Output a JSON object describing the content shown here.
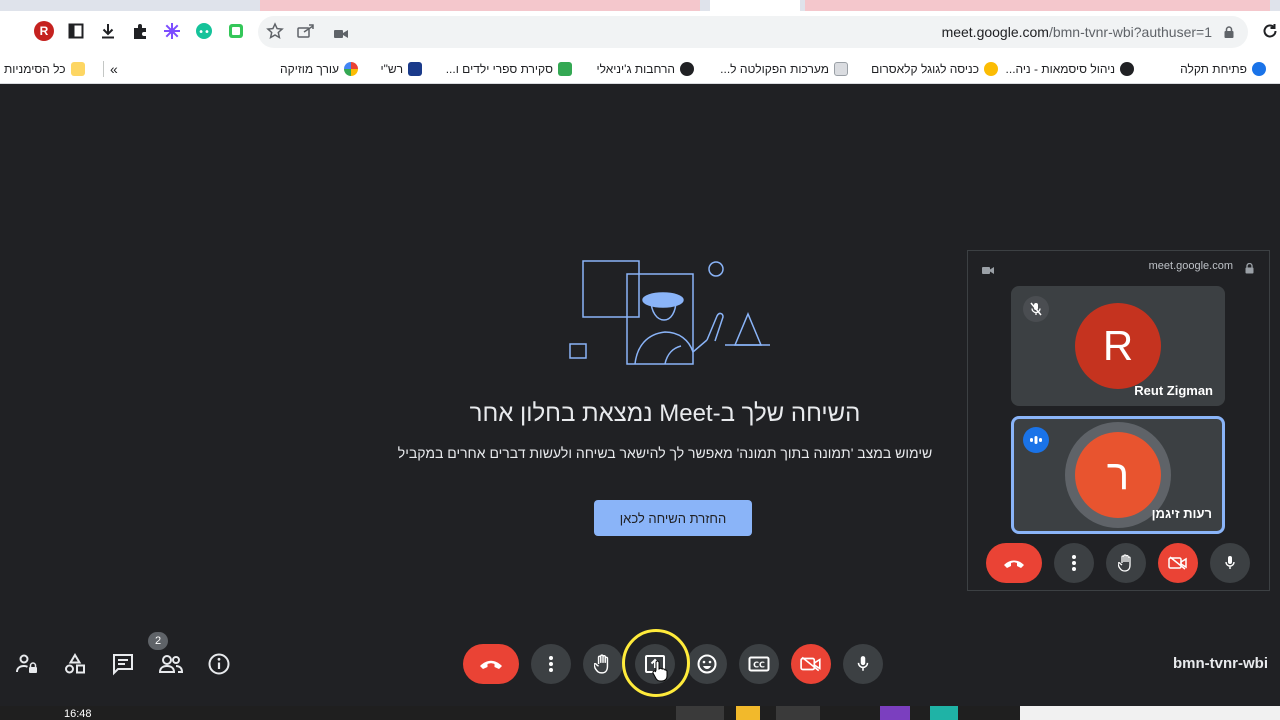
{
  "browser": {
    "url_domain": "meet.google.com",
    "url_path": "/bmn-tvnr-wbi?authuser=1",
    "profile_initial": "R",
    "bookmarks": [
      {
        "label": "פתיחת תקלה",
        "color": "#1a73e8"
      },
      {
        "label": "ניהול סיסמאות - ניה...",
        "color": "#202124"
      },
      {
        "label": "כניסה לגוגל קלאסרום",
        "color": "#fbbc04"
      },
      {
        "label": "מערכות הפקולטה ל...",
        "color": "#9aa0a6"
      },
      {
        "label": "הרחבות ג'יניאלי",
        "color": "#202124"
      },
      {
        "label": "סקירת ספרי ילדים ו...",
        "color": "#34a853"
      },
      {
        "label": "רש\"י",
        "color": "#1a3a8a"
      },
      {
        "label": "עורך מוזיקה",
        "color": "#ea4335"
      }
    ],
    "all_bookmarks_label": "כל הסימניות",
    "overflow_label": "»"
  },
  "main": {
    "headline": "השיחה שלך ב-Meet נמצאת בחלון אחר",
    "subline": "שימוש במצב 'תמונה בתוך תמונה' מאפשר לך להישאר בשיחה ולעשות דברים אחרים במקביל",
    "return_button": "החזרת השיחה לכאן"
  },
  "pip": {
    "url": "meet.google.com",
    "participants": [
      {
        "initial": "R",
        "name": "Reut Zigman",
        "muted": true
      },
      {
        "initial": "ר",
        "name": "רעות זיגמן",
        "speaking": true
      }
    ]
  },
  "bottom": {
    "meeting_code": "bmn-tvnr-wbi",
    "people_count": "2"
  },
  "taskbar": {
    "time": "16:48"
  }
}
